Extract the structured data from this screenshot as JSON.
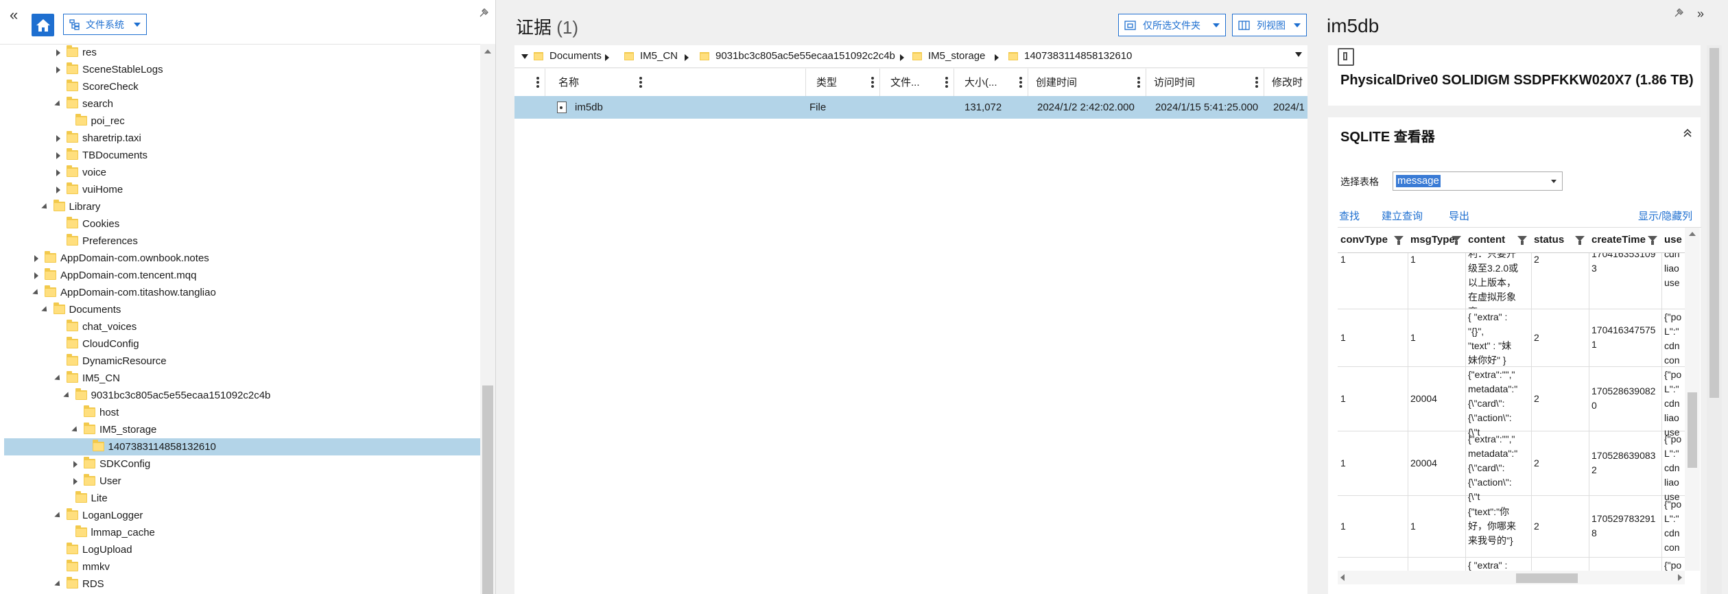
{
  "left": {
    "filesystem_label": "文件系统",
    "tree": [
      {
        "label": "res",
        "depth": 5,
        "toggle": "collapsed"
      },
      {
        "label": "SceneStableLogs",
        "depth": 5,
        "toggle": "collapsed"
      },
      {
        "label": "ScoreCheck",
        "depth": 5,
        "toggle": "none"
      },
      {
        "label": "search",
        "depth": 5,
        "toggle": "expanded"
      },
      {
        "label": "poi_rec",
        "depth": 6,
        "toggle": "none"
      },
      {
        "label": "sharetrip.taxi",
        "depth": 5,
        "toggle": "collapsed"
      },
      {
        "label": "TBDocuments",
        "depth": 5,
        "toggle": "collapsed"
      },
      {
        "label": "voice",
        "depth": 5,
        "toggle": "collapsed"
      },
      {
        "label": "vuiHome",
        "depth": 5,
        "toggle": "collapsed"
      },
      {
        "label": "Library",
        "depth": 4,
        "toggle": "expanded"
      },
      {
        "label": "Cookies",
        "depth": 5,
        "toggle": "none"
      },
      {
        "label": "Preferences",
        "depth": 5,
        "toggle": "none"
      },
      {
        "label": "AppDomain-com.ownbook.notes",
        "depth": 3,
        "toggle": "collapsed"
      },
      {
        "label": "AppDomain-com.tencent.mqq",
        "depth": 3,
        "toggle": "collapsed"
      },
      {
        "label": "AppDomain-com.titashow.tangliao",
        "depth": 3,
        "toggle": "expanded"
      },
      {
        "label": "Documents",
        "depth": 4,
        "toggle": "expanded"
      },
      {
        "label": "chat_voices",
        "depth": 5,
        "toggle": "none"
      },
      {
        "label": "CloudConfig",
        "depth": 5,
        "toggle": "none"
      },
      {
        "label": "DynamicResource",
        "depth": 5,
        "toggle": "none"
      },
      {
        "label": "IM5_CN",
        "depth": 5,
        "toggle": "expanded"
      },
      {
        "label": "9031bc3c805ac5e55ecaa151092c2c4b",
        "depth": 6,
        "toggle": "expanded"
      },
      {
        "label": "host",
        "depth": 7,
        "toggle": "none"
      },
      {
        "label": "IM5_storage",
        "depth": 7,
        "toggle": "expanded"
      },
      {
        "label": "1407383114858132610",
        "depth": 8,
        "toggle": "none",
        "selected": true
      },
      {
        "label": "SDKConfig",
        "depth": 7,
        "toggle": "collapsed"
      },
      {
        "label": "User",
        "depth": 7,
        "toggle": "collapsed"
      },
      {
        "label": "Lite",
        "depth": 6,
        "toggle": "none"
      },
      {
        "label": "LoganLogger",
        "depth": 5,
        "toggle": "expanded"
      },
      {
        "label": "lmmap_cache",
        "depth": 6,
        "toggle": "none"
      },
      {
        "label": "LogUpload",
        "depth": 5,
        "toggle": "none"
      },
      {
        "label": "mmkv",
        "depth": 5,
        "toggle": "none"
      },
      {
        "label": "RDS",
        "depth": 5,
        "toggle": "expanded"
      }
    ]
  },
  "mid": {
    "title": "证据",
    "count": "(1)",
    "only_selected_folder": "仅所选文件夹",
    "list_view": "列视图",
    "breadcrumb": [
      "Documents",
      "IM5_CN",
      "9031bc3c805ac5e55ecaa151092c2c4b",
      "IM5_storage",
      "1407383114858132610"
    ],
    "columns": [
      "名称",
      "类型",
      "文件...",
      "大小(...",
      "创建时间",
      "访问时间",
      "修改时"
    ],
    "row": {
      "name": "im5db",
      "type": "File",
      "file": "",
      "size": "131,072",
      "created": "2024/1/2 2:42:02.000",
      "accessed": "2024/1/15 5:41:25.000",
      "modified": "2024/1"
    }
  },
  "right": {
    "title": "im5db",
    "drive": "PhysicalDrive0 SOLIDIGM SSDPFKKW020X7 (1.86 TB)",
    "sqlite_title": "SQLITE 查看器",
    "select_table_label": "选择表格",
    "selected_table": "message",
    "links": {
      "find": "查找",
      "create_query": "建立查询",
      "export": "导出",
      "show_hide_columns": "显示/隐藏列"
    },
    "columns": [
      "convType",
      "msgType",
      "content",
      "status",
      "createTime",
      "use"
    ],
    "rows": [
      {
        "convType": "1",
        "msgType": "1",
        "content": "利：只要升\n级至3.2.0或\n以上版本，\n在虚拟形象\n商",
        "status": "2",
        "createTime": "170416353109\n3",
        "use": "cdn\nliao\nuse"
      },
      {
        "convType": "1",
        "msgType": "1",
        "content": "{ \"extra\" :\n\"{}\",\n\"text\" : \"妹\n妹你好\" }",
        "status": "2",
        "createTime": "170416347575\n1",
        "use": "{\"po\nL\":\"\ncdn\ncon"
      },
      {
        "convType": "1",
        "msgType": "20004",
        "content": "{\"extra\":\"\",\"\nmetadata\":\"\n{\\\"card\\\":\n{\\\"action\\\":\n{\\\"t",
        "status": "2",
        "createTime": "170528639082\n0",
        "use": "{\"po\nL\":\"\ncdn\nliao\nuse"
      },
      {
        "convType": "1",
        "msgType": "20004",
        "content": "{\"extra\":\"\",\"\nmetadata\":\"\n{\\\"card\\\":\n{\\\"action\\\":\n{\\\"t",
        "status": "2",
        "createTime": "170528639083\n2",
        "use": "{\"po\nL\":\"\ncdn\nliao\nuse"
      },
      {
        "convType": "1",
        "msgType": "1",
        "content": "{\"text\":\"你\n好，你哪来\n来我号的\"}",
        "status": "2",
        "createTime": "170529783291\n8",
        "use": "{\"po\nL\":\"\ncdn\ncon"
      },
      {
        "convType": "",
        "msgType": "",
        "content": "{ \"extra\" :",
        "status": "",
        "createTime": "",
        "use": "{\"po"
      }
    ]
  }
}
